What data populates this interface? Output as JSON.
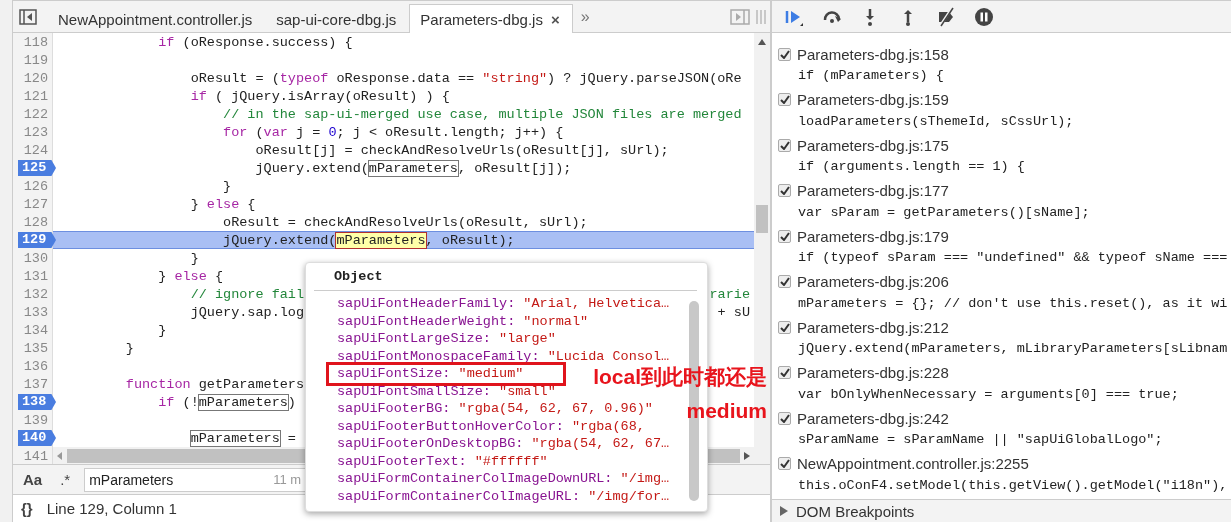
{
  "tabs": [
    {
      "label": "NewAppointment.controller.js",
      "selected": false
    },
    {
      "label": "sap-ui-core-dbg.js",
      "selected": false
    },
    {
      "label": "Parameters-dbg.js",
      "selected": true,
      "close": "×"
    }
  ],
  "tab_overflow": "»",
  "lines": [
    {
      "kind": "code",
      "number": "118",
      "breakpoint": false,
      "current": false,
      "tokens": [
        {
          "text": "            if",
          "kind": "keyword"
        },
        {
          "text": " (oResponse.success) {",
          "kind": "plain"
        }
      ]
    },
    {
      "kind": "code",
      "number": "119",
      "breakpoint": false,
      "current": false
    },
    {
      "kind": "code",
      "number": "120",
      "breakpoint": false,
      "current": false,
      "tokens": [
        {
          "text": "                oResult = (",
          "kind": "plain"
        },
        {
          "text": "typeof",
          "kind": "keyword"
        },
        {
          "text": " oResponse.data == ",
          "kind": "plain"
        },
        {
          "text": "\"string\"",
          "kind": "string"
        },
        {
          "text": ") ? jQuery.parseJSON(oRe",
          "kind": "plain"
        }
      ]
    },
    {
      "kind": "code",
      "number": "121",
      "breakpoint": false,
      "current": false,
      "tokens": [
        {
          "text": "                if",
          "kind": "keyword"
        },
        {
          "text": " ( jQuery.isArray(oResult) ) {",
          "kind": "plain"
        }
      ]
    },
    {
      "kind": "code",
      "number": "122",
      "breakpoint": false,
      "current": false,
      "tokens": [
        {
          "text": "                    // in the sap-ui-merged use case, multiple JSON files are merged",
          "kind": "comment"
        }
      ]
    },
    {
      "kind": "code",
      "number": "123",
      "breakpoint": false,
      "current": false,
      "tokens": [
        {
          "text": "                    for",
          "kind": "keyword"
        },
        {
          "text": " (",
          "kind": "plain"
        },
        {
          "text": "var",
          "kind": "keyword"
        },
        {
          "text": " j = ",
          "kind": "plain"
        },
        {
          "text": "0",
          "kind": "number"
        },
        {
          "text": "; j < oResult.length; j++) {",
          "kind": "plain"
        }
      ]
    },
    {
      "kind": "code",
      "number": "124",
      "breakpoint": false,
      "current": false,
      "tokens": [
        {
          "text": "                        oResult[j] = checkAndResolveUrls(oResult[j], sUrl);",
          "kind": "plain"
        }
      ]
    },
    {
      "kind": "code",
      "number": "125",
      "breakpoint": true,
      "current": false,
      "tokens": [
        {
          "text": "                        jQuery.extend(",
          "kind": "plain"
        },
        {
          "text": "mParameters",
          "kind": "boxed"
        },
        {
          "text": ", oResult[j]);",
          "kind": "plain"
        }
      ]
    },
    {
      "kind": "code",
      "number": "126",
      "breakpoint": false,
      "current": false,
      "tokens": [
        {
          "text": "                    }",
          "kind": "plain"
        }
      ]
    },
    {
      "kind": "code",
      "number": "127",
      "breakpoint": false,
      "current": false,
      "tokens": [
        {
          "text": "                } ",
          "kind": "plain"
        },
        {
          "text": "else",
          "kind": "keyword"
        },
        {
          "text": " {",
          "kind": "plain"
        }
      ]
    },
    {
      "kind": "code",
      "number": "128",
      "breakpoint": false,
      "current": false,
      "tokens": [
        {
          "text": "                    oResult = checkAndResolveUrls(oResult, sUrl);",
          "kind": "plain"
        }
      ]
    },
    {
      "kind": "code",
      "number": "129",
      "breakpoint": true,
      "current": true,
      "tokens": [
        {
          "text": "                    jQuery.extend(",
          "kind": "plain"
        },
        {
          "text": "mParameters",
          "kind": "hovered"
        },
        {
          "text": ", oResult);",
          "kind": "plain"
        }
      ]
    },
    {
      "kind": "code",
      "number": "130",
      "breakpoint": false,
      "current": false,
      "tokens": [
        {
          "text": "                }",
          "kind": "plain"
        }
      ]
    },
    {
      "kind": "code",
      "number": "131",
      "breakpoint": false,
      "current": false,
      "tokens": [
        {
          "text": "            } ",
          "kind": "plain"
        },
        {
          "text": "else",
          "kind": "keyword"
        },
        {
          "text": " {",
          "kind": "plain"
        }
      ]
    },
    {
      "kind": "code",
      "number": "132",
      "breakpoint": false,
      "current": false,
      "tokens": [
        {
          "text": "                // ignore fail",
          "kind": "comment"
        }
      ],
      "tail": {
        "text": "rarie",
        "kind": "comment"
      }
    },
    {
      "kind": "code",
      "number": "133",
      "breakpoint": false,
      "current": false,
      "tokens": [
        {
          "text": "                jQuery.sap.log",
          "kind": "plain"
        }
      ],
      "tail": {
        "text": "+ sU",
        "kind": "plain"
      }
    },
    {
      "kind": "code",
      "number": "134",
      "breakpoint": false,
      "current": false,
      "tokens": [
        {
          "text": "            }",
          "kind": "plain"
        }
      ]
    },
    {
      "kind": "code",
      "number": "135",
      "breakpoint": false,
      "current": false,
      "tokens": [
        {
          "text": "        }",
          "kind": "plain"
        }
      ]
    },
    {
      "kind": "code",
      "number": "136",
      "breakpoint": false,
      "current": false
    },
    {
      "kind": "code",
      "number": "137",
      "breakpoint": false,
      "current": false,
      "tokens": [
        {
          "text": "        function",
          "kind": "keyword"
        },
        {
          "text": " getParameters",
          "kind": "plain"
        }
      ]
    },
    {
      "kind": "code",
      "number": "138",
      "breakpoint": true,
      "current": false,
      "tokens": [
        {
          "text": "            if",
          "kind": "keyword"
        },
        {
          "text": " (!",
          "kind": "plain"
        },
        {
          "text": "mParameters",
          "kind": "boxed"
        },
        {
          "text": ")",
          "kind": "plain"
        }
      ]
    },
    {
      "kind": "code",
      "number": "139",
      "breakpoint": false,
      "current": false
    },
    {
      "kind": "code",
      "number": "140",
      "breakpoint": true,
      "current": false,
      "tokens": [
        {
          "text": "                mParameters",
          "kind": "boxed"
        },
        {
          "text": " =",
          "kind": "plain"
        }
      ]
    },
    {
      "kind": "scrollbar",
      "number": "141",
      "breakpoint": false
    }
  ],
  "search": {
    "case_toggle": "Aa",
    "regex_toggle": ".*",
    "value": "mParameters",
    "count": "11 m"
  },
  "status_bar": {
    "format_button": "{}",
    "position": "Line 129, Column 1"
  },
  "popover": {
    "title": "Object",
    "rows": [
      {
        "key": "sapUiFontHeaderFamily:",
        "value": "\"Arial, Helvetica…",
        "annotated": false
      },
      {
        "key": "sapUiFontHeaderWeight:",
        "value": "\"normal\"",
        "annotated": false
      },
      {
        "key": "sapUiFontLargeSize:",
        "value": "\"large\"",
        "annotated": false
      },
      {
        "key": "sapUiFontMonospaceFamily:",
        "value": "\"Lucida Consol…",
        "annotated": false
      },
      {
        "key": "sapUiFontSize:",
        "value": "\"medium\"",
        "annotated": true
      },
      {
        "key": "sapUiFontSmallSize:",
        "value": "\"small\"",
        "annotated": false
      },
      {
        "key": "sapUiFooterBG:",
        "value": "\"rgba(54, 62, 67, 0.96)\"",
        "annotated": false
      },
      {
        "key": "sapUiFooterButtonHoverColor:",
        "value": "\"rgba(68,",
        "annotated": false
      },
      {
        "key": "sapUiFooterOnDesktopBG:",
        "value": "\"rgba(54, 62, 67…",
        "annotated": false
      },
      {
        "key": "sapUiFooterText:",
        "value": "\"#ffffff\"",
        "annotated": false
      },
      {
        "key": "sapUiFormContainerColImageDownURL:",
        "value": "\"/img…",
        "annotated": false
      },
      {
        "key": "sapUiFormContainerColImageURL:",
        "value": "\"/img/for…",
        "annotated": false
      }
    ]
  },
  "annotation": {
    "lines": [
      "local到此时都还是",
      "medium"
    ]
  },
  "breakpoints": [
    {
      "location": "Parameters-dbg.js:158",
      "code": "if (mParameters) {",
      "checked": true
    },
    {
      "location": "Parameters-dbg.js:159",
      "code": "loadParameters(sThemeId, sCssUrl);",
      "checked": true
    },
    {
      "location": "Parameters-dbg.js:175",
      "code": "if (arguments.length == 1) {",
      "checked": true
    },
    {
      "location": "Parameters-dbg.js:177",
      "code": "var sParam = getParameters()[sName];",
      "checked": true
    },
    {
      "location": "Parameters-dbg.js:179",
      "code": "if (typeof sParam === \"undefined\" && typeof sName ===",
      "checked": true
    },
    {
      "location": "Parameters-dbg.js:206",
      "code": "mParameters = {}; // don't use this.reset(), as it wi",
      "checked": true
    },
    {
      "location": "Parameters-dbg.js:212",
      "code": "jQuery.extend(mParameters, mLibraryParameters[sLibnam",
      "checked": true
    },
    {
      "location": "Parameters-dbg.js:228",
      "code": "var bOnlyWhenNecessary = arguments[0] === true;",
      "checked": true
    },
    {
      "location": "Parameters-dbg.js:242",
      "code": "sParamName = sParamName || \"sapUiGlobalLogo\";",
      "checked": true
    },
    {
      "location": "NewAppointment.controller.js:2255",
      "code": "this.oConF4.setModel(this.getView().getModel(\"i18n\"),",
      "checked": true
    }
  ],
  "dom_breakpoints": {
    "label": "DOM Breakpoints",
    "expanded": false
  }
}
